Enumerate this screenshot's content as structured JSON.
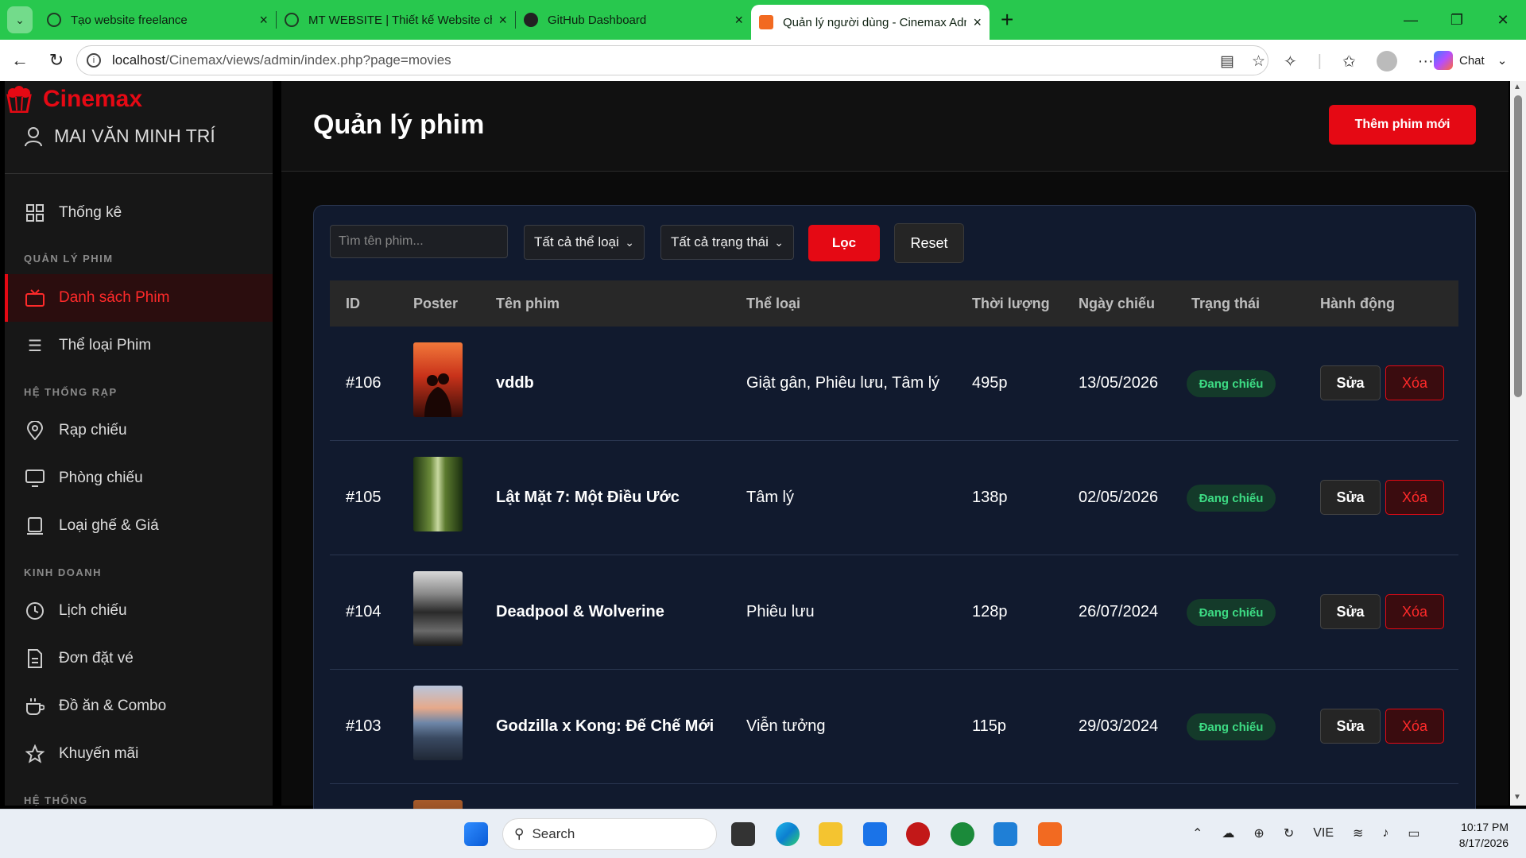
{
  "browser": {
    "tabs": [
      {
        "title": "Tạo website freelance"
      },
      {
        "title": "MT WEBSITE | Thiết kế Website chuyên nghiệp"
      },
      {
        "title": "GitHub Dashboard"
      },
      {
        "title": "Quản lý người dùng - Cinemax Admin"
      }
    ],
    "url_host": "localhost",
    "url_path": "/Cinemax/views/admin/index.php?page=movies",
    "chat_label": "Chat"
  },
  "sidebar": {
    "brand": "Cinemax",
    "user": "MAI VĂN MINH TRÍ",
    "dashboard": "Thống kê",
    "section_movies": "QUẢN LÝ PHIM",
    "movies_list": "Danh sách Phim",
    "movie_genres": "Thể loại Phim",
    "section_cinema": "HỆ THỐNG RẠP",
    "cinemas": "Rạp chiếu",
    "rooms": "Phòng chiếu",
    "seats": "Loại ghế & Giá",
    "section_business": "KINH DOANH",
    "showtimes": "Lịch chiếu",
    "orders": "Đơn đặt vé",
    "food": "Đồ ăn & Combo",
    "promotions": "Khuyến mãi",
    "section_system": "HỆ THỐNG"
  },
  "main": {
    "title": "Quản lý phim",
    "add_button": "Thêm phim mới",
    "search_placeholder": "Tìm tên phim...",
    "genre_select": "Tất cả thể loại",
    "status_select": "Tất cả trạng thái",
    "filter_button": "Lọc",
    "reset_button": "Reset",
    "columns": {
      "id": "ID",
      "poster": "Poster",
      "name": "Tên phim",
      "genre": "Thể loại",
      "duration": "Thời lượng",
      "date": "Ngày chiếu",
      "status": "Trạng thái",
      "actions": "Hành động"
    },
    "rows": [
      {
        "id": "#106",
        "name": "vddb",
        "genre": "Giật gân, Phiêu lưu, Tâm lý",
        "duration": "495p",
        "date": "13/05/2026",
        "status": "Đang chiếu",
        "edit": "Sửa",
        "delete": "Xóa"
      },
      {
        "id": "#105",
        "name": "Lật Mặt 7: Một Điều Ước",
        "genre": "Tâm lý",
        "duration": "138p",
        "date": "02/05/2026",
        "status": "Đang chiếu",
        "edit": "Sửa",
        "delete": "Xóa"
      },
      {
        "id": "#104",
        "name": "Deadpool & Wolverine",
        "genre": "Phiêu lưu",
        "duration": "128p",
        "date": "26/07/2024",
        "status": "Đang chiếu",
        "edit": "Sửa",
        "delete": "Xóa"
      },
      {
        "id": "#103",
        "name": "Godzilla x Kong: Đế Chế Mới",
        "genre": "Viễn tưởng",
        "duration": "115p",
        "date": "29/03/2024",
        "status": "Đang chiếu",
        "edit": "Sửa",
        "delete": "Xóa"
      }
    ]
  },
  "taskbar": {
    "search": "Search",
    "lang": "VIE",
    "time": "10:17 PM",
    "date": "8/17/2026"
  },
  "colors": {
    "accent": "#e50914",
    "tab_strip": "#28c84e",
    "panel": "#111a2e",
    "status_green": "#3ddc84"
  }
}
